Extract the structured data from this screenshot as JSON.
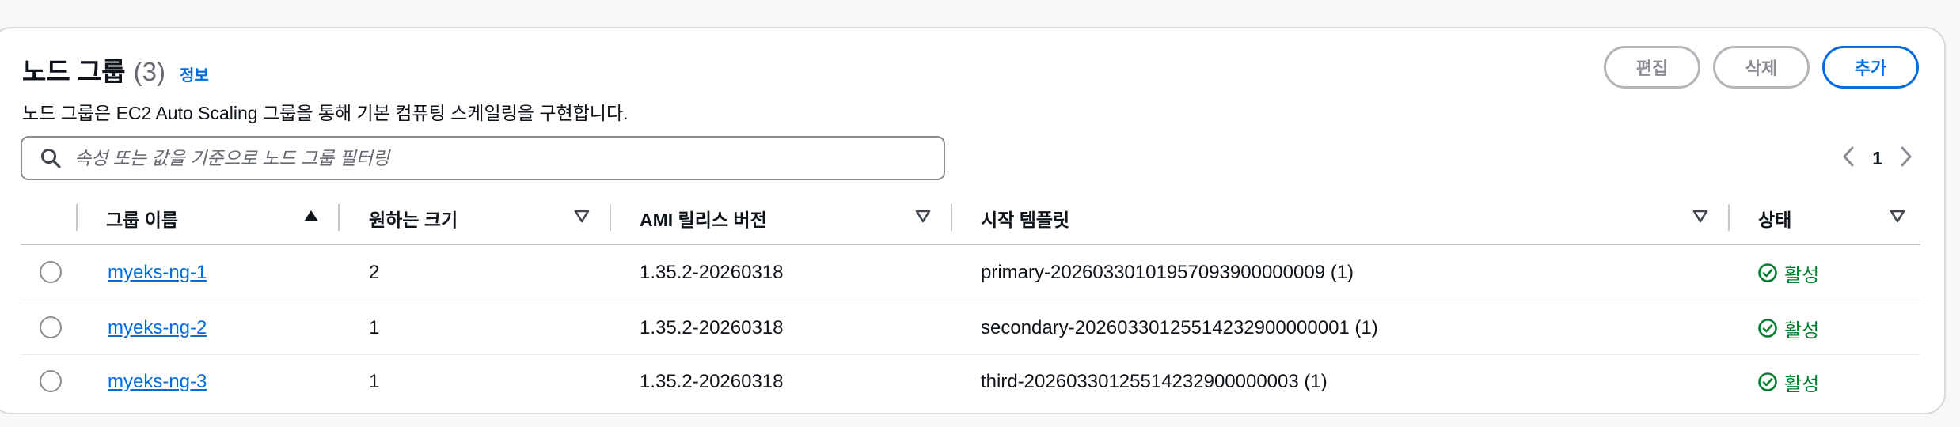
{
  "header": {
    "title": "노드 그룹",
    "count": "(3)",
    "info_link": "정보",
    "description": "노드 그룹은 EC2 Auto Scaling 그룹을 통해 기본 컴퓨팅 스케일링을 구현합니다."
  },
  "actions": {
    "edit": "편집",
    "delete": "삭제",
    "add": "추가"
  },
  "search": {
    "placeholder": "속성 또는 값을 기준으로 노드 그룹 필터링",
    "value": ""
  },
  "pagination": {
    "current_page": "1"
  },
  "columns": [
    {
      "label": "그룹 이름",
      "sort": "ascending"
    },
    {
      "label": "원하는 크기",
      "sort": "none"
    },
    {
      "label": "AMI 릴리스 버전",
      "sort": "none"
    },
    {
      "label": "시작 템플릿",
      "sort": "none"
    },
    {
      "label": "상태",
      "sort": "none"
    }
  ],
  "rows": [
    {
      "name": "myeks-ng-1",
      "desired_size": "2",
      "ami_version": "1.35.2-20260318",
      "launch_template": "primary-20260330101957093900000009 (1)",
      "status": "활성"
    },
    {
      "name": "myeks-ng-2",
      "desired_size": "1",
      "ami_version": "1.35.2-20260318",
      "launch_template": "secondary-20260330125514232900000001 (1)",
      "status": "활성"
    },
    {
      "name": "myeks-ng-3",
      "desired_size": "1",
      "ami_version": "1.35.2-20260318",
      "launch_template": "third-20260330125514232900000003 (1)",
      "status": "활성"
    }
  ],
  "colors": {
    "link": "#006ce0",
    "status_active": "#00802f",
    "text": "#0f141a",
    "muted": "#656871",
    "border": "#c6c6cd"
  },
  "icons": {
    "search": "search-icon",
    "prev": "chevron-left-icon",
    "next": "chevron-right-icon",
    "sort_asc": "sort-ascending-icon",
    "sort_none": "sort-descending-outline-icon",
    "status": "status-check-icon"
  }
}
